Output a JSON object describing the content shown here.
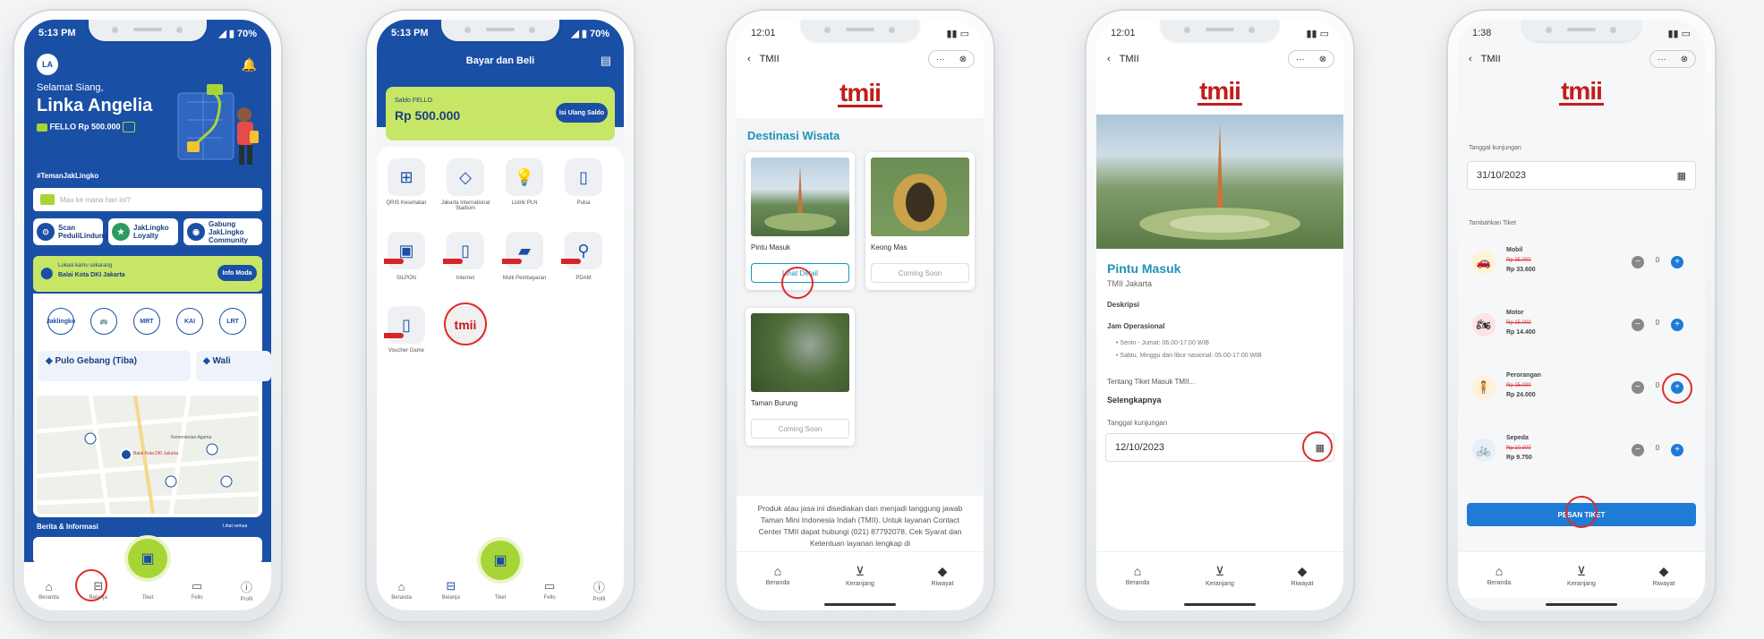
{
  "p1": {
    "time": "5:13 PM",
    "battery": "70%",
    "avatar": "LA",
    "greeting": "Selamat Siang,",
    "name": "Linka Angelia",
    "balance": "FELLO Rp 500.000",
    "hashtag": "#TemanJakLingko",
    "search_placeholder": "Mau ke mana hari ini?",
    "quick": [
      "Scan PeduliLindungi",
      "JakLingko Loyalty",
      "Gabung JakLingko Community"
    ],
    "location_label": "Lokasi kamu sekarang",
    "location": "Balai Kota DKI Jakarta",
    "info_btn": "Info Moda",
    "operators": [
      "Jaklingko",
      "Transjakarta",
      "MRT",
      "KAI",
      "LRT"
    ],
    "route1": "Pulo Gebang (Tiba)",
    "route2": "Wali",
    "map_labels": [
      "Balai Kota DKI Jakarta",
      "Kementerian Agama"
    ],
    "news": "Berita & Informasi",
    "news_more": "Lihat semua",
    "nav": [
      "Beranda",
      "Belanja",
      "Tiket",
      "Fello",
      "Profil"
    ]
  },
  "p2": {
    "time": "5:13 PM",
    "battery": "70%",
    "title": "Bayar dan Beli",
    "saldo_label": "Saldo FELLO",
    "saldo": "Rp 500.000",
    "topup": "Isi Ulang Saldo",
    "menu": [
      "QRIS Kesehatan",
      "Jakarta International Stadium",
      "Listrik PLN",
      "Pulsa",
      "SILPON",
      "Internet",
      "Multi Pembayaran",
      "PDAM",
      "Voucher Game",
      ""
    ],
    "badge": "Segera",
    "nav": [
      "Beranda",
      "Belanja",
      "Tiket",
      "Fello",
      "Profil"
    ]
  },
  "p3": {
    "time": "12:01",
    "title": "TMII",
    "logo": "tmii",
    "heading": "Destinasi Wisata",
    "cards": [
      {
        "name": "Pintu Masuk",
        "btn": "Lihat Detail"
      },
      {
        "name": "Keong Mas",
        "btn": "Coming Soon"
      },
      {
        "name": "Taman Burung",
        "btn": "Coming Soon"
      }
    ],
    "footer": "Produk atau jasa ini disediakan dan menjadi tanggung jawab Taman Mini Indonesia Indah (TMII). Untuk layanan Contact Center TMII dapat hubungi (021) 87792078. Cek Syarat dan Ketentuan layanan lengkap di",
    "nav": [
      "Beranda",
      "Keranjang",
      "Riwayat"
    ]
  },
  "p4": {
    "time": "12:01",
    "title": "TMII",
    "logo": "tmii",
    "place": "Pintu Masuk",
    "city": "TMII Jakarta",
    "desc": "Deskripsi",
    "hours_title": "Jam Operasional",
    "hours": [
      "Senin - Jumat: 06.00-17.00 WIB",
      "Sabtu, Minggu dan libur nasional: 05.00-17.00 WIB"
    ],
    "about": "Tentang Tiket Masuk TMII...",
    "more": "Selengkapnya",
    "date_label": "Tanggal kunjungan",
    "date": "12/10/2023",
    "nav": [
      "Beranda",
      "Keranjang",
      "Riwayat"
    ]
  },
  "p5": {
    "time": "1:38",
    "title": "TMII",
    "logo": "tmii",
    "date_label": "Tanggal kunjungan",
    "date": "31/10/2023",
    "add_label": "Tambahkan Tiket",
    "tickets": [
      {
        "name": "Mobil",
        "old": "Rp 35.000",
        "price": "Rp 33.600",
        "qty": "0"
      },
      {
        "name": "Motor",
        "old": "Rp 15.000",
        "price": "Rp 14.400",
        "qty": "0"
      },
      {
        "name": "Perorangan",
        "old": "Rp 25.000",
        "price": "Rp 24.000",
        "qty": "0"
      },
      {
        "name": "Sepeda",
        "old": "Rp 10.000",
        "price": "Rp 9.750",
        "qty": "0"
      }
    ],
    "order_btn": "PESAN TIKET",
    "nav": [
      "Beranda",
      "Keranjang",
      "Riwayat"
    ]
  }
}
